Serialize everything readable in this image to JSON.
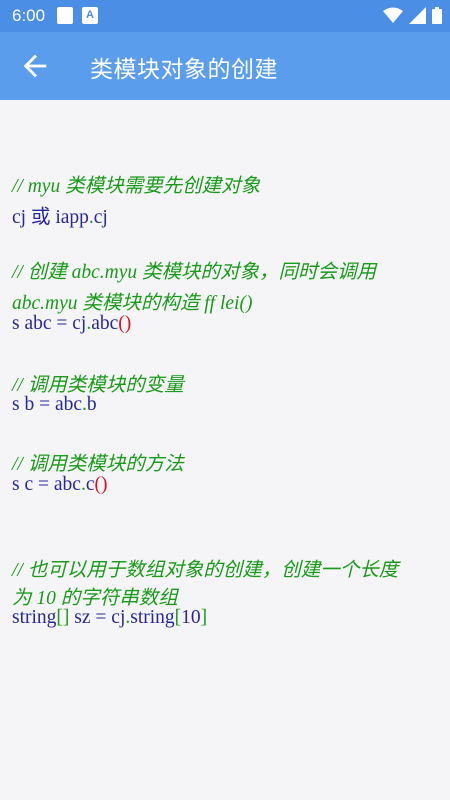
{
  "status_bar": {
    "time": "6:00",
    "notification_icon_letter": "A",
    "icons": [
      "app-notification-icon",
      "download-notification-icon",
      "wifi-icon",
      "cellular-signal-icon",
      "battery-icon"
    ]
  },
  "app_bar": {
    "back_icon": "arrow-back-icon",
    "title": "类模块对象的创建"
  },
  "colors": {
    "status_bar": "#4a8ee6",
    "app_bar": "#5b9ded",
    "background": "#f5f5f7",
    "comment": "#1a9a1a",
    "code": "#27279c",
    "paren": "#d8101a"
  },
  "code": {
    "c1": "// myu 类模块需要先创建对象",
    "l1": {
      "a": "cj 或 iapp",
      "dot": ".",
      "b": "cj"
    },
    "c2a": "// 创建 abc.myu 类模块的对象，同时会调用",
    "c2b": "abc.myu 类模块的构造 ff lei()",
    "l2": {
      "a": "s abc = cj",
      "dot": ".",
      "b": "abc",
      "paren": "()"
    },
    "c3": "// 调用类模块的变量",
    "l3": {
      "a": "s b = abc",
      "dot": ".",
      "b": "b"
    },
    "c4": "// 调用类模块的方法",
    "l4": {
      "a": "s c = abc",
      "dot": ".",
      "b": "c",
      "paren": "()"
    },
    "c5a": "// 也可以用于数组对象的创建，创建一个长度",
    "c5b": "为 10 的字符串数组",
    "l5": {
      "a": "string",
      "brk1": "[]",
      "b": " sz = cj",
      "dot": ".",
      "c": "string",
      "brk2": "[",
      "num": "10",
      "brk3": "]"
    }
  }
}
